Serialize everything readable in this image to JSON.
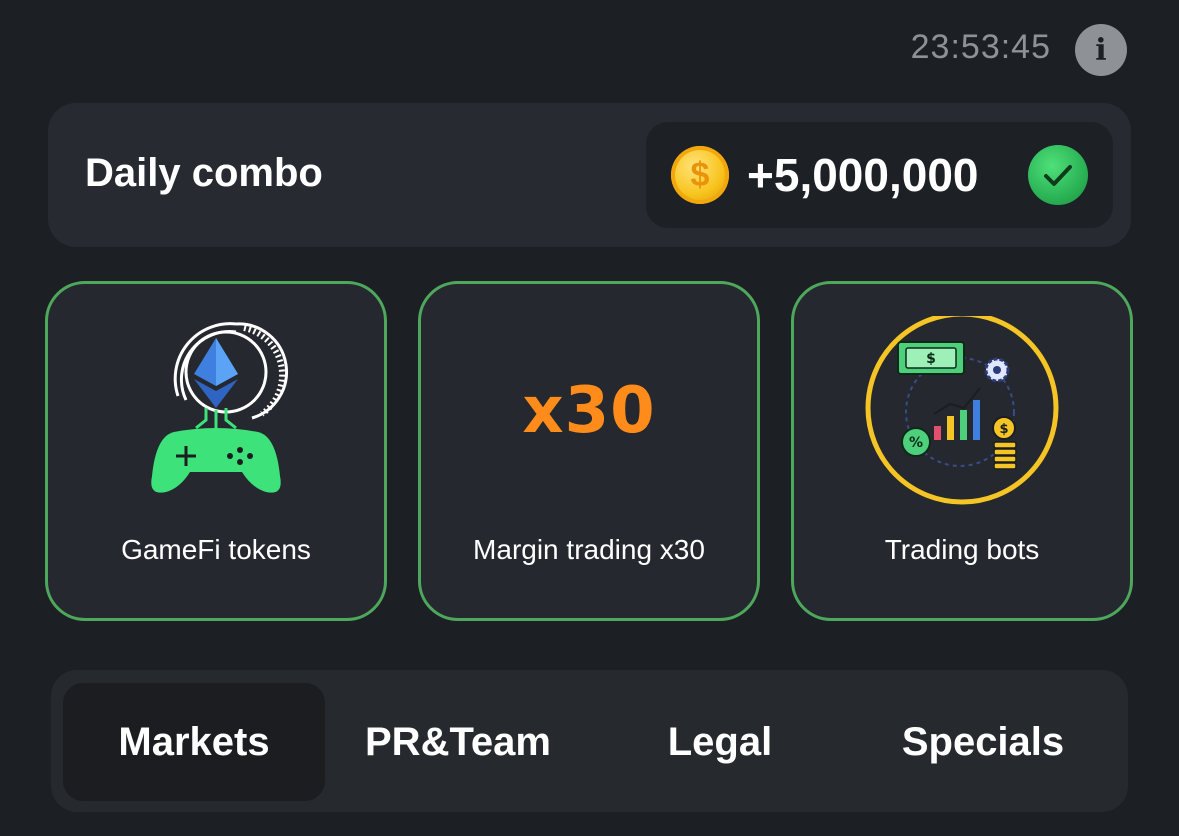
{
  "header": {
    "timer": "23:53:45",
    "info_icon": "info-icon"
  },
  "combo": {
    "title": "Daily combo",
    "reward": "+5,000,000",
    "reward_icon": "coin-icon",
    "status_icon": "check-icon",
    "status": "completed"
  },
  "cards": [
    {
      "label": "GameFi tokens",
      "icon": "gamepad-ethereum-icon",
      "border_color": "#4ea85c"
    },
    {
      "label": "Margin trading x30",
      "art_text": "x30",
      "icon": "x30-text",
      "art_color": "#ff8c1a",
      "border_color": "#4ea85c"
    },
    {
      "label": "Trading bots",
      "icon": "trading-bot-icon",
      "border_color": "#4ea85c"
    }
  ],
  "tabs": [
    {
      "label": "Markets",
      "active": true
    },
    {
      "label": "PR&Team",
      "active": false
    },
    {
      "label": "Legal",
      "active": false
    },
    {
      "label": "Specials",
      "active": false
    }
  ],
  "colors": {
    "background": "#1c1f24",
    "panel": "#272a30",
    "accent_green": "#4ea85c",
    "accent_orange": "#ff8c1a",
    "gold": "#f8c41e"
  }
}
